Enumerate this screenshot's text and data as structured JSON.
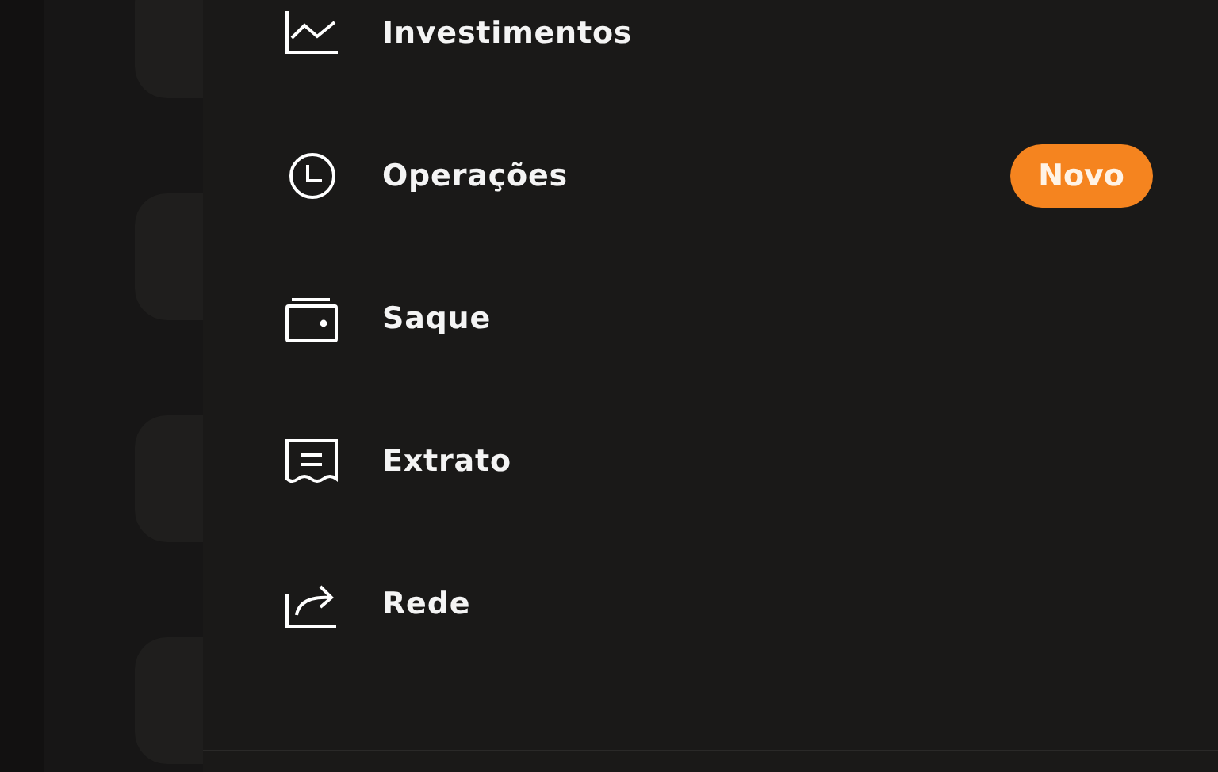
{
  "menu": {
    "items": [
      {
        "label": "Investimentos"
      },
      {
        "label": "Operações",
        "badge": "Novo"
      },
      {
        "label": "Saque"
      },
      {
        "label": "Extrato"
      },
      {
        "label": "Rede"
      }
    ]
  }
}
